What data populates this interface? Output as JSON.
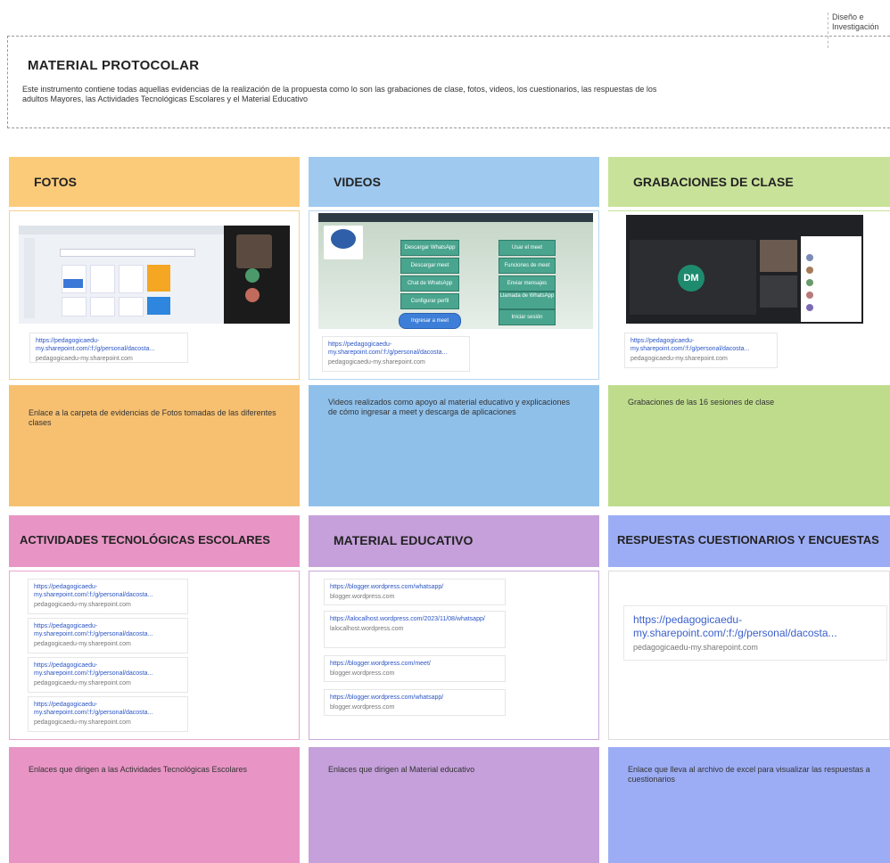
{
  "corner_note": "Diseño e Investigación",
  "header": {
    "title": "MATERIAL PROTOCOLAR",
    "description": "Este instrumento contiene todas aquellas evidencias de la realización de la propuesta como lo son las grabaciones de clase, fotos, videos, los cuestionarios, las respuestas de los adultos Mayores, las Actividades Tecnológicas Escolares y el Material Educativo"
  },
  "columns": [
    {
      "title": "FOTOS",
      "link": {
        "url": "https://pedagogicaedu-my.sharepoint.com/:f:/g/personal/dacosta...",
        "domain": "pedagogicaedu-my.sharepoint.com"
      },
      "description": "Enlace a la carpeta de evidencias de Fotos tomadas de las diferentes clases"
    },
    {
      "title": "VIDEOS",
      "link": {
        "url": "https://pedagogicaedu-my.sharepoint.com/:f:/g/personal/dacosta...",
        "domain": "pedagogicaedu-my.sharepoint.com"
      },
      "description": "Videos realizados como apoyo al material educativo y explicaciones de cómo ingresar a meet y descarga de aplicaciones",
      "app_buttons": [
        "Descargar WhatsApp",
        "Descargar meet",
        "Chat de WhatsApp",
        "Configurar perfil",
        "Ingresar a meet",
        "Usar el meet",
        "Funciones de meet",
        "Enviar mensajes",
        "Llamada de WhatsApp",
        "Iniciar sesión"
      ]
    },
    {
      "title": "GRABACIONES DE CLASE",
      "link": {
        "url": "https://pedagogicaedu-my.sharepoint.com/:f:/g/personal/dacosta...",
        "domain": "pedagogicaedu-my.sharepoint.com"
      },
      "description": "Grabaciones de las 16 sesiones de clase",
      "avatar_initials": "DM"
    },
    {
      "title": "ACTIVIDADES TECNOLÓGICAS ESCOLARES",
      "links": [
        {
          "url": "https://pedagogicaedu-my.sharepoint.com/:f:/g/personal/dacosta...",
          "domain": "pedagogicaedu-my.sharepoint.com"
        },
        {
          "url": "https://pedagogicaedu-my.sharepoint.com/:f:/g/personal/dacosta...",
          "domain": "pedagogicaedu-my.sharepoint.com"
        },
        {
          "url": "https://pedagogicaedu-my.sharepoint.com/:f:/g/personal/dacosta...",
          "domain": "pedagogicaedu-my.sharepoint.com"
        },
        {
          "url": "https://pedagogicaedu-my.sharepoint.com/:f:/g/personal/dacosta...",
          "domain": "pedagogicaedu-my.sharepoint.com"
        }
      ],
      "description": "Enlaces que dirigen a las Actividades Tecnológicas Escolares"
    },
    {
      "title": "MATERIAL EDUCATIVO",
      "links": [
        {
          "url": "https://blogger.wordpress.com/whatsapp/",
          "domain": "blogger.wordpress.com"
        },
        {
          "url": "https://lalocalhost.wordpress.com/2023/11/08/whatsapp/",
          "domain": "lalocalhost.wordpress.com"
        },
        {
          "url": "https://blogger.wordpress.com/meet/",
          "domain": "blogger.wordpress.com"
        },
        {
          "url": "https://blogger.wordpress.com/whatsapp/",
          "domain": "blogger.wordpress.com"
        }
      ],
      "description": "Enlaces que dirigen al Material educativo"
    },
    {
      "title": "RESPUESTAS CUESTIONARIOS Y ENCUESTAS",
      "link": {
        "url": "https://pedagogicaedu-my.sharepoint.com/:f:/g/personal/dacosta...",
        "domain": "pedagogicaedu-my.sharepoint.com"
      },
      "description": "Enlace que lleva al archivo de excel para visualizar las respuestas a cuestionarios"
    }
  ],
  "colors": {
    "orange": "#fccb7a",
    "orange_dark": "#f7c071",
    "blue": "#9fc9ef",
    "blue_dark": "#8fc0ea",
    "green": "#c9e29a",
    "green_dark": "#bfdc8d",
    "pink": "#e895c5",
    "purple": "#c5a0db",
    "periwinkle": "#9dadf5"
  }
}
